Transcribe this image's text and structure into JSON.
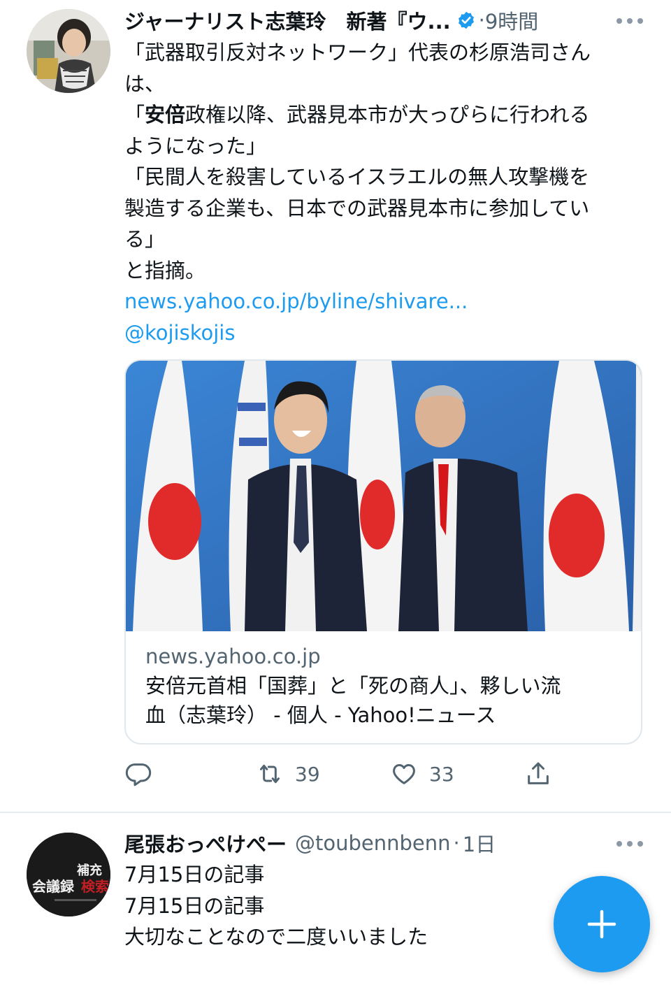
{
  "tweets": [
    {
      "author_name": "ジャーナリスト志葉玲　新著『ウ...",
      "verified": true,
      "separator": "·",
      "time": "9時間",
      "text_lines": [
        "「武器取引反対ネットワーク」代表の杉原浩司さん",
        "は、",
        "「",
        "安倍",
        "政権以降、武器見本市が大っぴらに行われる",
        "ようになった」",
        "「民間人を殺害しているイスラエルの無人攻撃機を",
        "製造する企業も、日本での武器見本市に参加してい",
        "る」",
        "と指摘。"
      ],
      "link_url": "news.yahoo.co.jp/byline/shivare...",
      "mention": "@kojiskojis",
      "card": {
        "domain": "news.yahoo.co.jp",
        "title_line1": "安倍元首相「国葬」と「死の商人」、夥しい流",
        "title_line2": "血（志葉玲） - 個人 - Yahoo!ニュース"
      },
      "actions": {
        "retweets": "39",
        "likes": "33"
      }
    },
    {
      "author_name": "尾張おっぺけぺー",
      "handle": "@toubennbenn",
      "separator": "·",
      "time": "1日",
      "avatar_text_top": "補充",
      "avatar_text_mid": "会議録",
      "avatar_text_red": "検索",
      "text_lines": [
        "7月15日の記事",
        "7月15日の記事",
        "大切なことなので二度いいました"
      ]
    }
  ],
  "colors": {
    "accent": "#1d9bf0",
    "text": "#0f1419",
    "secondary": "#536471",
    "border": "#e1e8ed"
  },
  "icons": [
    "reply-icon",
    "retweet-icon",
    "like-icon",
    "share-icon",
    "verified-badge-icon",
    "more-icon",
    "compose-plus-icon"
  ]
}
